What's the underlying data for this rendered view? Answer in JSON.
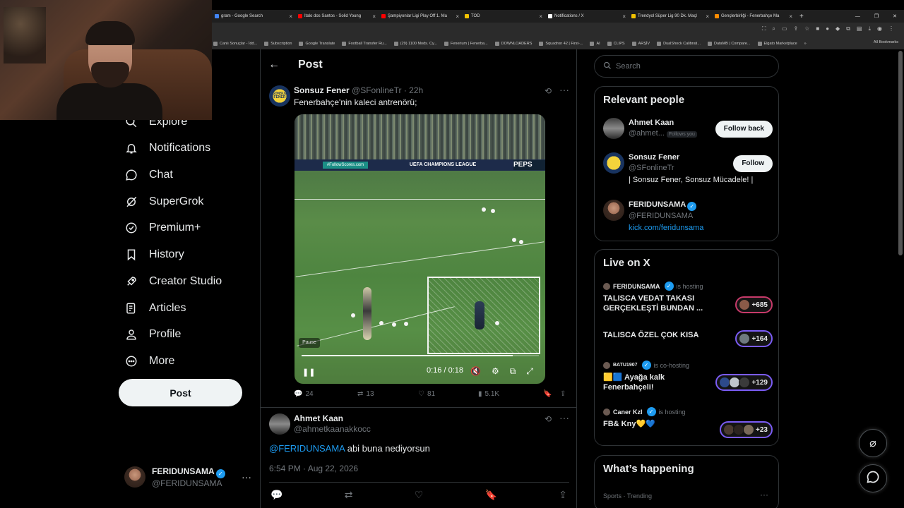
{
  "browser": {
    "tabs": [
      {
        "label": "gram - Google Search",
        "color": "#4285f4"
      },
      {
        "label": "İtalo dos Santos - Solid Young",
        "color": "#ff0000"
      },
      {
        "label": "Şampiyonlar Ligi Play Off 1. Ma",
        "color": "#ff0000"
      },
      {
        "label": "TOD",
        "color": "#f2c200"
      },
      {
        "label": "Notifications / X",
        "color": "#ffffff"
      },
      {
        "label": "Trendyol Süper Lig 90 Dk. Maçl",
        "color": "#f2c200"
      },
      {
        "label": "Gençlerbirliği - Fenerbahçe Ma",
        "color": "#ff8c00"
      }
    ],
    "bookmarks": [
      "Canlı Sonuçlar - İdd...",
      "Subscription",
      "Google Translate",
      "Football Transfer Ru...",
      "(29) 1100 Mods. Cy...",
      "Fenerium | Fenerba...",
      "DOWNLOADERS",
      "Squadron 42 | First-...",
      "AI",
      "CLIPS",
      "ARŞİV",
      "DualShock Calibrati...",
      "DataMB | Compare...",
      "Elgato Marketplace"
    ],
    "all_bookmarks": "All Bookmarks"
  },
  "nav": {
    "items": [
      {
        "label": "Explore",
        "icon": "search-icon"
      },
      {
        "label": "Notifications",
        "icon": "bell-icon"
      },
      {
        "label": "Chat",
        "icon": "chat-icon"
      },
      {
        "label": "SuperGrok",
        "icon": "grok-icon"
      },
      {
        "label": "Premium+",
        "icon": "premium-icon"
      },
      {
        "label": "History",
        "icon": "bookmark-icon"
      },
      {
        "label": "Creator Studio",
        "icon": "rocket-icon"
      },
      {
        "label": "Articles",
        "icon": "article-icon"
      },
      {
        "label": "Profile",
        "icon": "person-icon"
      },
      {
        "label": "More",
        "icon": "more-circle-icon"
      }
    ],
    "post_label": "Post",
    "me": {
      "name": "FERIDUNSAMA",
      "handle": "@FERIDUNSAMA"
    }
  },
  "post_page": {
    "title": "Post",
    "tweet": {
      "name": "Sonsuz Fener",
      "handle": "@SFonlineTr",
      "time": "· 22h",
      "text": "Fenerbahçe'nin kaleci antrenörü;",
      "avatar_text": "SONSUZ FENER",
      "video": {
        "board_left": "#FollowScores.com",
        "board_center": "UEFA CHAMPIONS LEAGUE",
        "board_right": "PEPS",
        "pause_tip": "Pause",
        "time": "0:16 / 0:18",
        "progress": 0.889
      },
      "stats": {
        "replies": "24",
        "reposts": "13",
        "likes": "81",
        "views": "5.1K"
      }
    },
    "reply": {
      "name": "Ahmet Kaan",
      "handle": "@ahmetkaanakkocc",
      "mention": "@FERIDUNSAMA",
      "text": " abi buna nediyorsun",
      "timestamp": "6:54 PM · Aug 22, 2026"
    }
  },
  "sidebar": {
    "search_placeholder": "Search",
    "relevant": {
      "title": "Relevant people",
      "people": [
        {
          "name": "Ahmet Kaan",
          "handle": "@ahmet...",
          "badge": "Follows you",
          "button": "Follow back"
        },
        {
          "name": "Sonsuz Fener",
          "handle": "@SFonlineTr",
          "bio": "| Sonsuz Fener, Sonsuz Mücadele! |",
          "button": "Follow"
        },
        {
          "name": "FERIDUNSAMA",
          "handle": "@FERIDUNSAMA",
          "link": "kick.com/feridunsama"
        }
      ]
    },
    "live": {
      "title": "Live on X",
      "items": [
        {
          "host": "FERIDUNSAMA",
          "role": "is hosting",
          "title": "TALISCA VEDAT TAKASI GERÇEKLEŞTİ BUNDAN ...",
          "count": "+685"
        },
        {
          "host": "",
          "role": "",
          "title": "TALISCA ÖZEL ÇOK KISA",
          "count": "+164"
        },
        {
          "host": "BATU1907",
          "role": "is co-hosting",
          "title": "🟨🟦 Ayağa kalk Fenerbahçeli!",
          "count": "+129"
        },
        {
          "host": "Caner Kzl",
          "role": "is hosting",
          "title": "FB& Kny💛💙",
          "count": "+23"
        }
      ]
    },
    "whats_happening": {
      "title": "What’s happening",
      "trend_label": "Sports · Trending"
    }
  }
}
